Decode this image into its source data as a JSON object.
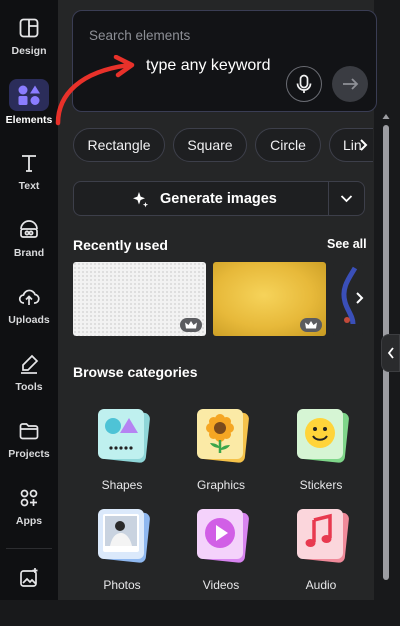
{
  "sidebar": {
    "items": [
      {
        "label": "Design",
        "icon": "layout-icon",
        "active": false
      },
      {
        "label": "Elements",
        "icon": "shapes-icon",
        "active": true
      },
      {
        "label": "Text",
        "icon": "text-icon",
        "active": false
      },
      {
        "label": "Brand",
        "icon": "brand-icon",
        "active": false
      },
      {
        "label": "Uploads",
        "icon": "cloud-upload-icon",
        "active": false
      },
      {
        "label": "Tools",
        "icon": "pen-icon",
        "active": false
      },
      {
        "label": "Projects",
        "icon": "folder-icon",
        "active": false
      },
      {
        "label": "Apps",
        "icon": "apps-grid-icon",
        "active": false
      }
    ],
    "accent": "#2b2d5a"
  },
  "search": {
    "placeholder": "Search elements",
    "annotation": "type any keyword",
    "annotation_arrow_color": "#e8312a"
  },
  "chips": [
    "Rectangle",
    "Square",
    "Circle",
    "Lin"
  ],
  "generate": {
    "label": "Generate images"
  },
  "recent": {
    "title": "Recently used",
    "see_all": "See all"
  },
  "categories": {
    "title": "Browse categories",
    "items": [
      {
        "label": "Shapes",
        "icon": "shapes-tile-icon"
      },
      {
        "label": "Graphics",
        "icon": "sunflower-tile-icon"
      },
      {
        "label": "Stickers",
        "icon": "smiley-tile-icon"
      },
      {
        "label": "Photos",
        "icon": "photo-tile-icon"
      },
      {
        "label": "Videos",
        "icon": "play-tile-icon"
      },
      {
        "label": "Audio",
        "icon": "music-tile-icon"
      }
    ]
  }
}
